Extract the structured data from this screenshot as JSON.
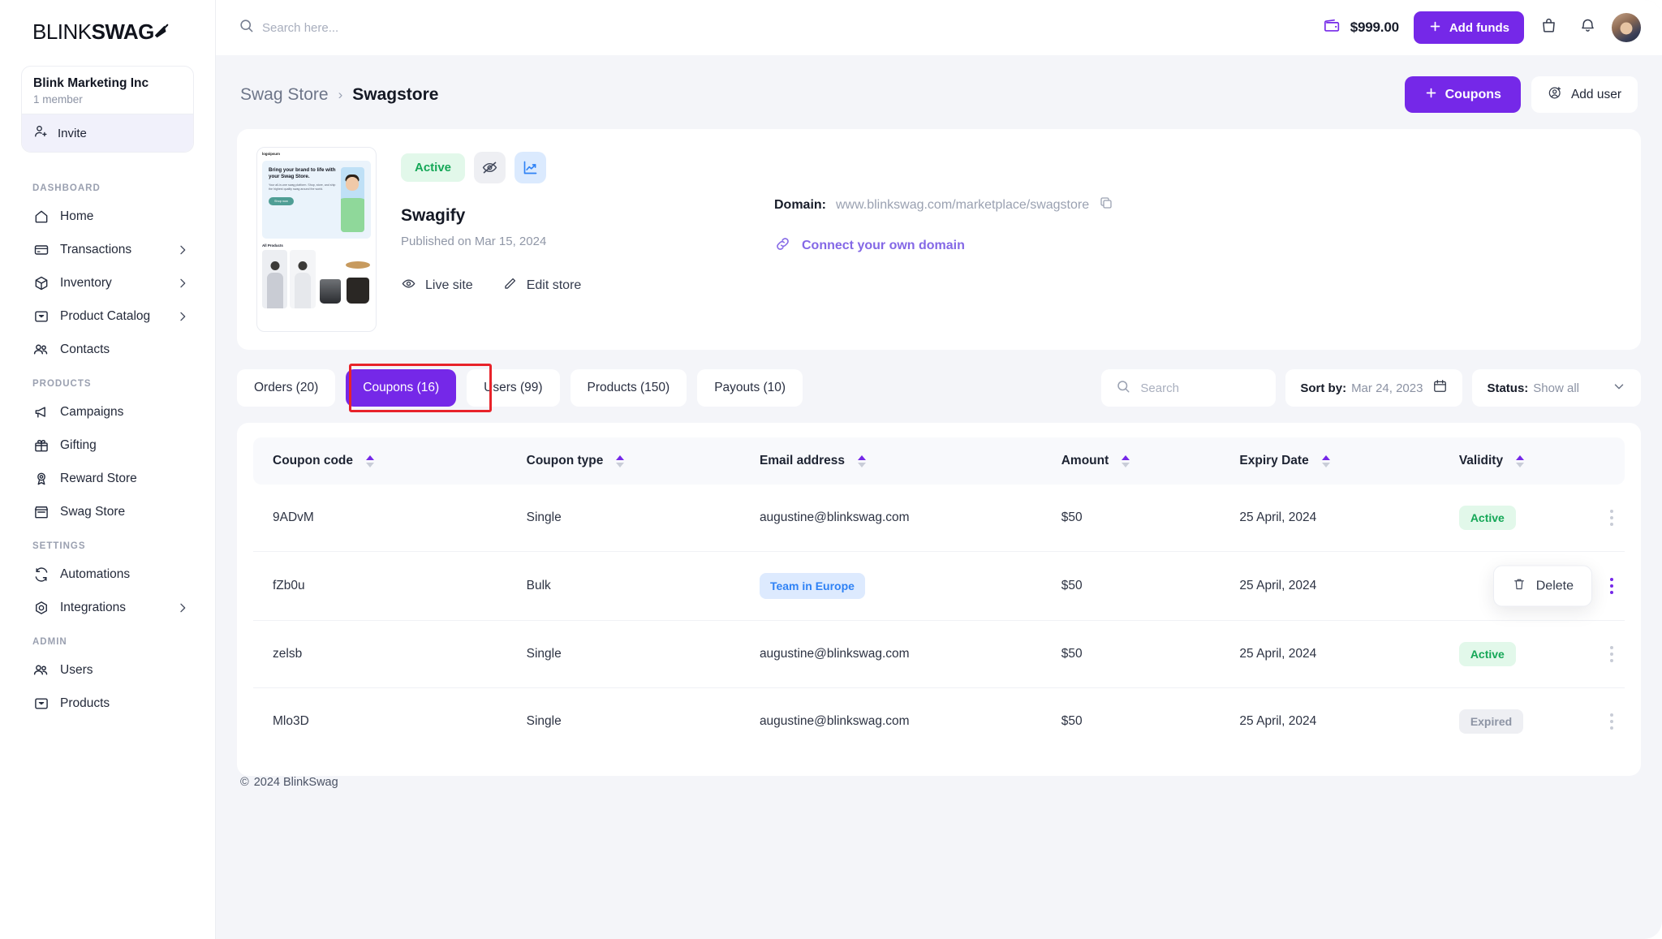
{
  "brand": {
    "name_bold": "BLINK",
    "name_light": "SWAG",
    "logo_icon": "rocket-icon"
  },
  "org": {
    "name": "Blink Marketing Inc",
    "members": "1 member",
    "invite_label": "Invite",
    "invite_icon": "user-plus-icon"
  },
  "sidebar": {
    "sections": [
      {
        "title": "DASHBOARD",
        "items": [
          {
            "label": "Home",
            "icon": "home-icon",
            "chevron": false
          },
          {
            "label": "Transactions",
            "icon": "card-icon",
            "chevron": true
          },
          {
            "label": "Inventory",
            "icon": "box-icon",
            "chevron": true
          },
          {
            "label": "Product Catalog",
            "icon": "catalog-icon",
            "chevron": true
          },
          {
            "label": "Contacts",
            "icon": "users-icon",
            "chevron": false
          }
        ]
      },
      {
        "title": "PRODUCTS",
        "items": [
          {
            "label": "Campaigns",
            "icon": "megaphone-icon",
            "chevron": false
          },
          {
            "label": "Gifting",
            "icon": "gift-icon",
            "chevron": false
          },
          {
            "label": "Reward Store",
            "icon": "award-icon",
            "chevron": false
          },
          {
            "label": "Swag Store",
            "icon": "store-icon",
            "chevron": false
          }
        ]
      },
      {
        "title": "SETTINGS",
        "items": [
          {
            "label": "Automations",
            "icon": "refresh-icon",
            "chevron": false
          },
          {
            "label": "Integrations",
            "icon": "target-icon",
            "chevron": true
          }
        ]
      },
      {
        "title": "ADMIN",
        "items": [
          {
            "label": "Users",
            "icon": "users-icon",
            "chevron": false
          },
          {
            "label": "Products",
            "icon": "catalog-icon",
            "chevron": false
          }
        ]
      }
    ]
  },
  "topbar": {
    "search_placeholder": "Search here...",
    "search_value": "",
    "search_icon": "search-icon",
    "wallet_icon": "wallet-icon",
    "wallet_amount": "$999.00",
    "add_funds_label": "Add funds",
    "bag_icon": "shopping-bag-icon",
    "bell_icon": "bell-icon",
    "avatar": "user-avatar"
  },
  "page": {
    "breadcrumb_parent": "Swag Store",
    "breadcrumb_sep": "›",
    "breadcrumb_current": "Swagstore",
    "coupons_button": "Coupons",
    "add_user_button": "Add user",
    "add_user_icon": "user-circle-plus-icon"
  },
  "store": {
    "status_chip": "Active",
    "hide_icon": "eye-off-icon",
    "analytics_icon": "trending-chart-icon",
    "name": "Swagify",
    "published": "Published on Mar 15, 2024",
    "live_site_label": "Live site",
    "live_site_icon": "eye-icon",
    "edit_store_label": "Edit store",
    "edit_store_icon": "pencil-icon",
    "domain_label": "Domain:",
    "domain_value": "www.blinkswag.com/marketplace/swagstore",
    "copy_icon": "copy-icon",
    "connect_label": "Connect your own domain",
    "connect_icon": "link-icon",
    "preview": {
      "logo": "logoipsum",
      "headline": "Bring your brand to life with your Swag Store.",
      "subtext": "Your all-in-one swag platform. Shop, store, and ship the highest quality swag around the world.",
      "cta": "Shop now",
      "section_title": "All Products"
    }
  },
  "tabs": [
    {
      "label": "Orders (20)",
      "active": false
    },
    {
      "label": "Coupons (16)",
      "active": true
    },
    {
      "label": "Users (99)",
      "active": false
    },
    {
      "label": "Products (150)",
      "active": false
    },
    {
      "label": "Payouts (10)",
      "active": false
    }
  ],
  "filters": {
    "search_placeholder": "Search",
    "search_value": "",
    "search_icon": "search-icon",
    "sort_label": "Sort by:",
    "sort_value": "Mar 24, 2023",
    "calendar_icon": "calendar-icon",
    "status_label": "Status:",
    "status_value": "Show all",
    "chevron_icon": "chevron-down-icon"
  },
  "table": {
    "columns": [
      {
        "label": "Coupon code",
        "sortable": true
      },
      {
        "label": "Coupon type",
        "sortable": true
      },
      {
        "label": "Email address",
        "sortable": true
      },
      {
        "label": "Amount",
        "sortable": true
      },
      {
        "label": "Expiry Date",
        "sortable": true
      },
      {
        "label": "Validity",
        "sortable": true
      }
    ],
    "rows": [
      {
        "code": "9ADvM",
        "type": "Single",
        "email": "augustine@blinkswag.com",
        "email_is_badge": false,
        "amount": "$50",
        "expiry": "25 April, 2024",
        "validity": "Active",
        "validity_state": "active",
        "menu_open": false
      },
      {
        "code": "fZb0u",
        "type": "Bulk",
        "email": "Team in Europe",
        "email_is_badge": true,
        "amount": "$50",
        "expiry": "25 April, 2024",
        "validity": "",
        "validity_state": "none",
        "menu_open": true
      },
      {
        "code": "zelsb",
        "type": "Single",
        "email": "augustine@blinkswag.com",
        "email_is_badge": false,
        "amount": "$50",
        "expiry": "25 April, 2024",
        "validity": "Active",
        "validity_state": "active",
        "menu_open": false
      },
      {
        "code": "Mlo3D",
        "type": "Single",
        "email": "augustine@blinkswag.com",
        "email_is_badge": false,
        "amount": "$50",
        "expiry": "25 April, 2024",
        "validity": "Expired",
        "validity_state": "expired",
        "menu_open": false
      }
    ],
    "row_menu": {
      "delete_label": "Delete",
      "delete_icon": "trash-icon"
    }
  },
  "footer": {
    "copyright": "2024 BlinkSwag",
    "copyright_symbol": "©"
  },
  "colors": {
    "accent": "#7528e8",
    "accent_soft": "#8468e6",
    "success_bg": "#e2f8ea",
    "success_fg": "#15a757",
    "neutral_bg": "#eeeff3",
    "neutral_fg": "#8d94a4",
    "info_bg": "#ddeafe",
    "info_fg": "#2f82f5",
    "page_bg": "#f4f5f9",
    "annotation": "#e8232a"
  }
}
